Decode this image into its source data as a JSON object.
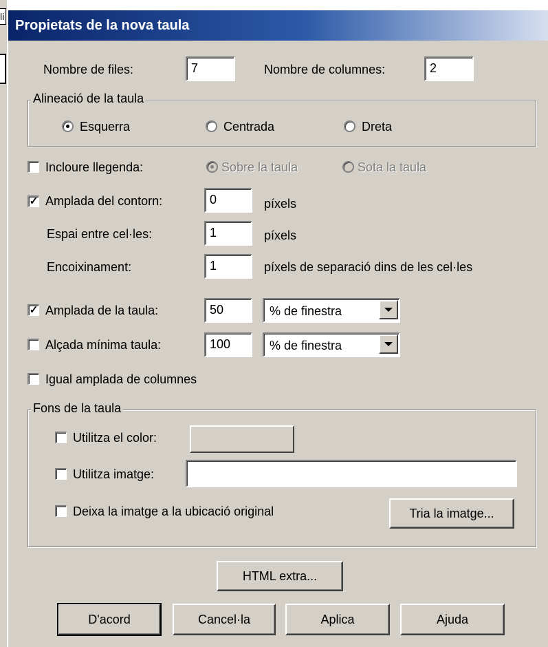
{
  "title": "Propietats de la nova taula",
  "background_fragment": "li",
  "rows": {
    "label": "Nombre de files:",
    "value": "7"
  },
  "columns": {
    "label": "Nombre de columnes:",
    "value": "2"
  },
  "alignment": {
    "legend": "Alineació de la taula",
    "options": [
      "Esquerra",
      "Centrada",
      "Dreta"
    ],
    "selected": "Esquerra"
  },
  "caption": {
    "label": "Incloure llegenda:",
    "checked": false,
    "options": [
      "Sobre la taula",
      "Sota la taula"
    ],
    "selected": "Sobre la taula"
  },
  "border": {
    "label": "Amplada del contorn:",
    "checked": true,
    "value": "0",
    "unit": "píxels"
  },
  "spacing": {
    "label": "Espai entre cel·les:",
    "value": "1",
    "unit": "píxels"
  },
  "padding": {
    "label": "Encoixinament:",
    "value": "1",
    "unit": "píxels de separació dins de les cel·les"
  },
  "width": {
    "label": "Amplada de la taula:",
    "checked": true,
    "value": "50",
    "unit": "% de finestra"
  },
  "min_height": {
    "label": "Alçada mínima taula:",
    "checked": false,
    "value": "100",
    "unit": "% de finestra"
  },
  "equal_columns": {
    "label": "Igual amplada de columnes",
    "checked": false
  },
  "background": {
    "legend": "Fons de la taula",
    "use_color": {
      "label": "Utilitza el color:",
      "checked": false
    },
    "use_image": {
      "label": "Utilitza imatge:",
      "checked": false,
      "value": ""
    },
    "keep_original": {
      "label": "Deixa la imatge a la ubicació original",
      "checked": false
    },
    "choose_image_button": "Tria la imatge..."
  },
  "buttons": {
    "extra_html": "HTML extra...",
    "ok": "D'acord",
    "cancel": "Cancel·la",
    "apply": "Aplica",
    "help": "Ajuda"
  },
  "colors": {
    "dialog_bg": "#d4d0c8",
    "title_start": "#0a246a",
    "title_end": "#d6dff0",
    "disabled_text": "#808080"
  }
}
